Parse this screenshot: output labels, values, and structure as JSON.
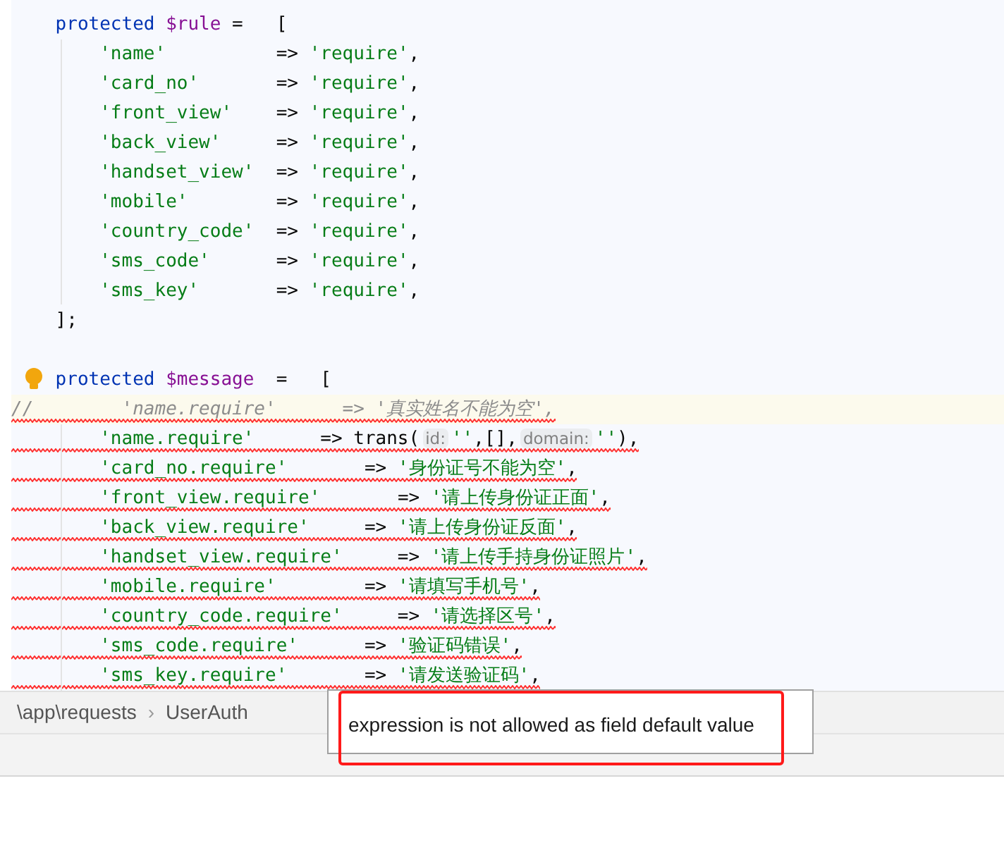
{
  "editor": {
    "lines": [
      {
        "kind": "statement",
        "error": false,
        "highlighted": false,
        "bulb": false,
        "tokens": [
          {
            "kind": "keyword",
            "text": "protected "
          },
          {
            "kind": "variable",
            "text": "$rule"
          },
          {
            "kind": "plain",
            "text": " =   ["
          }
        ]
      },
      {
        "kind": "entry",
        "error": false,
        "highlighted": false,
        "bulb": false,
        "tokens": [
          {
            "kind": "string",
            "text": "'name'"
          },
          {
            "kind": "plain",
            "text": "          => "
          },
          {
            "kind": "string",
            "text": "'require'"
          },
          {
            "kind": "plain",
            "text": ","
          }
        ]
      },
      {
        "kind": "entry",
        "error": false,
        "highlighted": false,
        "bulb": false,
        "tokens": [
          {
            "kind": "string",
            "text": "'card_no'"
          },
          {
            "kind": "plain",
            "text": "       => "
          },
          {
            "kind": "string",
            "text": "'require'"
          },
          {
            "kind": "plain",
            "text": ","
          }
        ]
      },
      {
        "kind": "entry",
        "error": false,
        "highlighted": false,
        "bulb": false,
        "tokens": [
          {
            "kind": "string",
            "text": "'front_view'"
          },
          {
            "kind": "plain",
            "text": "    => "
          },
          {
            "kind": "string",
            "text": "'require'"
          },
          {
            "kind": "plain",
            "text": ","
          }
        ]
      },
      {
        "kind": "entry",
        "error": false,
        "highlighted": false,
        "bulb": false,
        "tokens": [
          {
            "kind": "string",
            "text": "'back_view'"
          },
          {
            "kind": "plain",
            "text": "     => "
          },
          {
            "kind": "string",
            "text": "'require'"
          },
          {
            "kind": "plain",
            "text": ","
          }
        ]
      },
      {
        "kind": "entry",
        "error": false,
        "highlighted": false,
        "bulb": false,
        "tokens": [
          {
            "kind": "string",
            "text": "'handset_view'"
          },
          {
            "kind": "plain",
            "text": "  => "
          },
          {
            "kind": "string",
            "text": "'require'"
          },
          {
            "kind": "plain",
            "text": ","
          }
        ]
      },
      {
        "kind": "entry",
        "error": false,
        "highlighted": false,
        "bulb": false,
        "tokens": [
          {
            "kind": "string",
            "text": "'mobile'"
          },
          {
            "kind": "plain",
            "text": "        => "
          },
          {
            "kind": "string",
            "text": "'require'"
          },
          {
            "kind": "plain",
            "text": ","
          }
        ]
      },
      {
        "kind": "entry",
        "error": false,
        "highlighted": false,
        "bulb": false,
        "tokens": [
          {
            "kind": "string",
            "text": "'country_code'"
          },
          {
            "kind": "plain",
            "text": "  => "
          },
          {
            "kind": "string",
            "text": "'require'"
          },
          {
            "kind": "plain",
            "text": ","
          }
        ]
      },
      {
        "kind": "entry",
        "error": false,
        "highlighted": false,
        "bulb": false,
        "tokens": [
          {
            "kind": "string",
            "text": "'sms_code'"
          },
          {
            "kind": "plain",
            "text": "      => "
          },
          {
            "kind": "string",
            "text": "'require'"
          },
          {
            "kind": "plain",
            "text": ","
          }
        ]
      },
      {
        "kind": "entry",
        "error": false,
        "highlighted": false,
        "bulb": false,
        "tokens": [
          {
            "kind": "string",
            "text": "'sms_key'"
          },
          {
            "kind": "plain",
            "text": "       => "
          },
          {
            "kind": "string",
            "text": "'require'"
          },
          {
            "kind": "plain",
            "text": ","
          }
        ]
      },
      {
        "kind": "statement",
        "error": false,
        "highlighted": false,
        "bulb": false,
        "tokens": [
          {
            "kind": "plain",
            "text": "];"
          }
        ]
      },
      {
        "kind": "blank"
      },
      {
        "kind": "statement",
        "error": false,
        "highlighted": false,
        "bulb": true,
        "tokens": [
          {
            "kind": "keyword",
            "text": "protected "
          },
          {
            "kind": "variable",
            "text": "$message"
          },
          {
            "kind": "plain",
            "text": "  =   ["
          }
        ]
      },
      {
        "kind": "comment",
        "error": true,
        "highlighted": true,
        "bulb": false,
        "tokens": [
          {
            "kind": "comment",
            "text": "//        'name.require'      => '真实姓名不能为空',"
          }
        ]
      },
      {
        "kind": "entry",
        "error": true,
        "highlighted": false,
        "bulb": false,
        "tokens": [
          {
            "kind": "string",
            "text": "'name.require'"
          },
          {
            "kind": "plain",
            "text": "      => trans("
          },
          {
            "kind": "hint",
            "text": "id:"
          },
          {
            "kind": "string",
            "text": "''"
          },
          {
            "kind": "plain",
            "text": ",[],"
          },
          {
            "kind": "hint",
            "text": "domain:"
          },
          {
            "kind": "string",
            "text": "''"
          },
          {
            "kind": "plain",
            "text": "),"
          }
        ]
      },
      {
        "kind": "entry",
        "error": true,
        "highlighted": false,
        "bulb": false,
        "tokens": [
          {
            "kind": "string",
            "text": "'card_no.require'"
          },
          {
            "kind": "plain",
            "text": "       => "
          },
          {
            "kind": "string",
            "text": "'身份证号不能为空'"
          },
          {
            "kind": "plain",
            "text": ","
          }
        ]
      },
      {
        "kind": "entry",
        "error": true,
        "highlighted": false,
        "bulb": false,
        "tokens": [
          {
            "kind": "string",
            "text": "'front_view.require'"
          },
          {
            "kind": "plain",
            "text": "       => "
          },
          {
            "kind": "string",
            "text": "'请上传身份证正面'"
          },
          {
            "kind": "plain",
            "text": ","
          }
        ]
      },
      {
        "kind": "entry",
        "error": true,
        "highlighted": false,
        "bulb": false,
        "tokens": [
          {
            "kind": "string",
            "text": "'back_view.require'"
          },
          {
            "kind": "plain",
            "text": "     => "
          },
          {
            "kind": "string",
            "text": "'请上传身份证反面'"
          },
          {
            "kind": "plain",
            "text": ","
          }
        ]
      },
      {
        "kind": "entry",
        "error": true,
        "highlighted": false,
        "bulb": false,
        "tokens": [
          {
            "kind": "string",
            "text": "'handset_view.require'"
          },
          {
            "kind": "plain",
            "text": "     => "
          },
          {
            "kind": "string",
            "text": "'请上传手持身份证照片'"
          },
          {
            "kind": "plain",
            "text": ","
          }
        ]
      },
      {
        "kind": "entry",
        "error": true,
        "highlighted": false,
        "bulb": false,
        "tokens": [
          {
            "kind": "string",
            "text": "'mobile.require'"
          },
          {
            "kind": "plain",
            "text": "        => "
          },
          {
            "kind": "string",
            "text": "'请填写手机号'"
          },
          {
            "kind": "plain",
            "text": ","
          }
        ]
      },
      {
        "kind": "entry",
        "error": true,
        "highlighted": false,
        "bulb": false,
        "tokens": [
          {
            "kind": "string",
            "text": "'country_code.require'"
          },
          {
            "kind": "plain",
            "text": "     => "
          },
          {
            "kind": "string",
            "text": "'请选择区号'"
          },
          {
            "kind": "plain",
            "text": ","
          }
        ]
      },
      {
        "kind": "entry",
        "error": true,
        "highlighted": false,
        "bulb": false,
        "tokens": [
          {
            "kind": "string",
            "text": "'sms_code.require'"
          },
          {
            "kind": "plain",
            "text": "      => "
          },
          {
            "kind": "string",
            "text": "'验证码错误'"
          },
          {
            "kind": "plain",
            "text": ","
          }
        ]
      },
      {
        "kind": "entry",
        "error": true,
        "highlighted": false,
        "bulb": false,
        "tokens": [
          {
            "kind": "string",
            "text": "'sms_key.require'"
          },
          {
            "kind": "plain",
            "text": "       => "
          },
          {
            "kind": "string",
            "text": "'请发送验证码'"
          },
          {
            "kind": "plain",
            "text": ","
          }
        ]
      }
    ]
  },
  "breadcrumbs": [
    {
      "text": "\\app\\requests"
    },
    {
      "text": "UserAuth"
    }
  ],
  "breadcrumb_separator": "›",
  "tooltip": {
    "text": "expression is not allowed as field default value"
  }
}
